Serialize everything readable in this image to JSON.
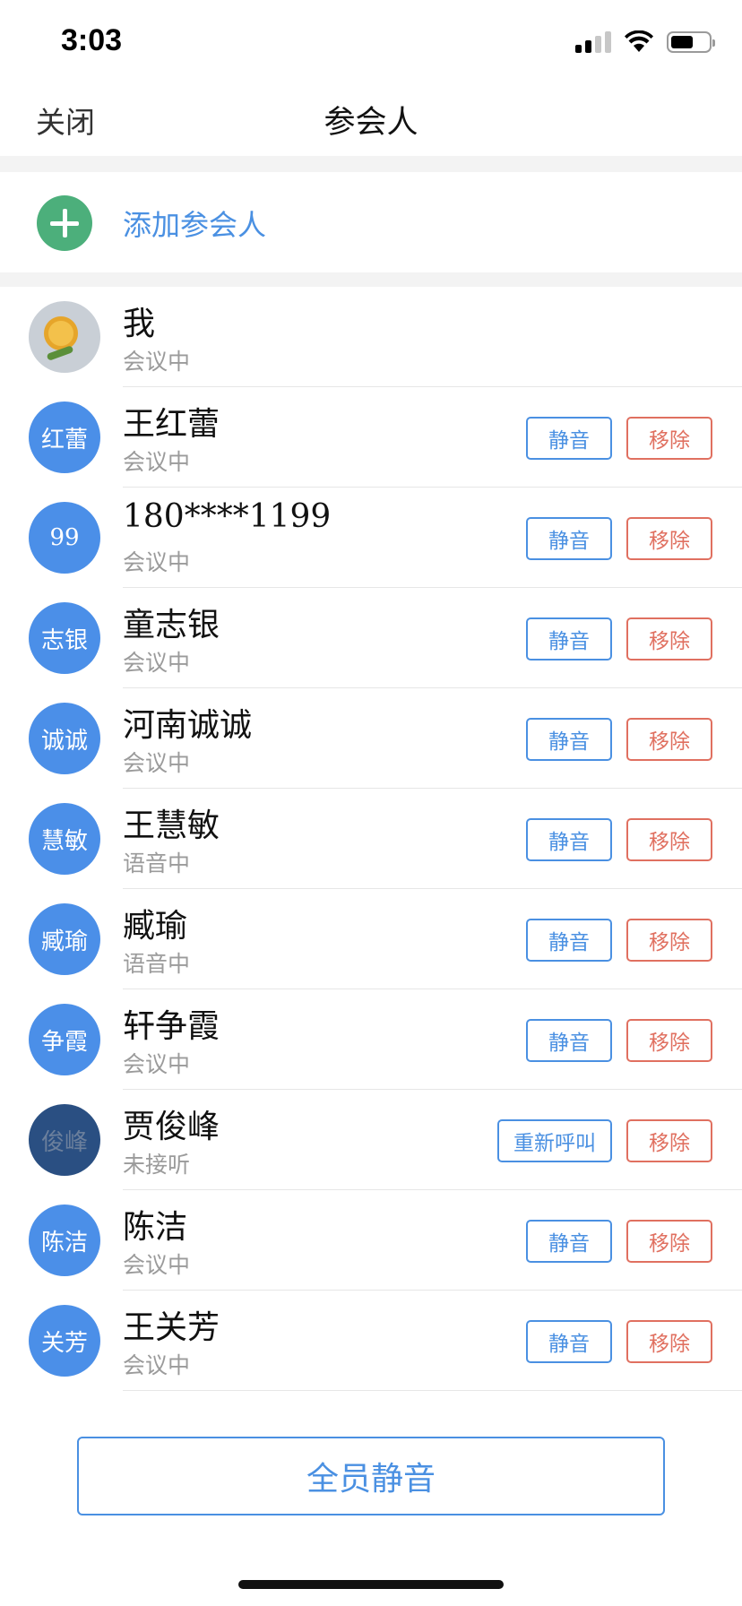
{
  "status_bar": {
    "time": "3:03"
  },
  "nav": {
    "close_label": "关闭",
    "title": "参会人"
  },
  "add_participant": {
    "label": "添加参会人"
  },
  "participants": [
    {
      "avatar_text": "",
      "avatar_style": "photo",
      "name": "我",
      "status": "会议中",
      "actions": []
    },
    {
      "avatar_text": "红蕾",
      "avatar_style": "blue",
      "name": "王红蕾",
      "status": "会议中",
      "actions": [
        "静音",
        "移除"
      ]
    },
    {
      "avatar_text": "99",
      "avatar_style": "blue",
      "name": "180****1199",
      "status": "会议中",
      "actions": [
        "静音",
        "移除"
      ]
    },
    {
      "avatar_text": "志银",
      "avatar_style": "blue",
      "name": "童志银",
      "status": "会议中",
      "actions": [
        "静音",
        "移除"
      ]
    },
    {
      "avatar_text": "诚诚",
      "avatar_style": "blue",
      "name": "河南诚诚",
      "status": "会议中",
      "actions": [
        "静音",
        "移除"
      ]
    },
    {
      "avatar_text": "慧敏",
      "avatar_style": "blue",
      "name": "王慧敏",
      "status": "语音中",
      "actions": [
        "静音",
        "移除"
      ]
    },
    {
      "avatar_text": "臧瑜",
      "avatar_style": "blue",
      "name": "臧瑜",
      "status": "语音中",
      "actions": [
        "静音",
        "移除"
      ]
    },
    {
      "avatar_text": "争霞",
      "avatar_style": "blue",
      "name": "轩争霞",
      "status": "会议中",
      "actions": [
        "静音",
        "移除"
      ]
    },
    {
      "avatar_text": "俊峰",
      "avatar_style": "dark",
      "name": "贾俊峰",
      "status": "未接听",
      "actions": [
        "重新呼叫",
        "移除"
      ]
    },
    {
      "avatar_text": "陈洁",
      "avatar_style": "blue",
      "name": "陈洁",
      "status": "会议中",
      "actions": [
        "静音",
        "移除"
      ]
    },
    {
      "avatar_text": "关芳",
      "avatar_style": "blue",
      "name": "王关芳",
      "status": "会议中",
      "actions": [
        "静音",
        "移除"
      ]
    }
  ],
  "bottom": {
    "mute_all_label": "全员静音"
  },
  "colors": {
    "accent_blue": "#4a90e2",
    "remove_red": "#e07060",
    "add_green": "#4caf7b",
    "avatar_blue": "#4b8fe8",
    "avatar_dark": "#2a4f82"
  }
}
